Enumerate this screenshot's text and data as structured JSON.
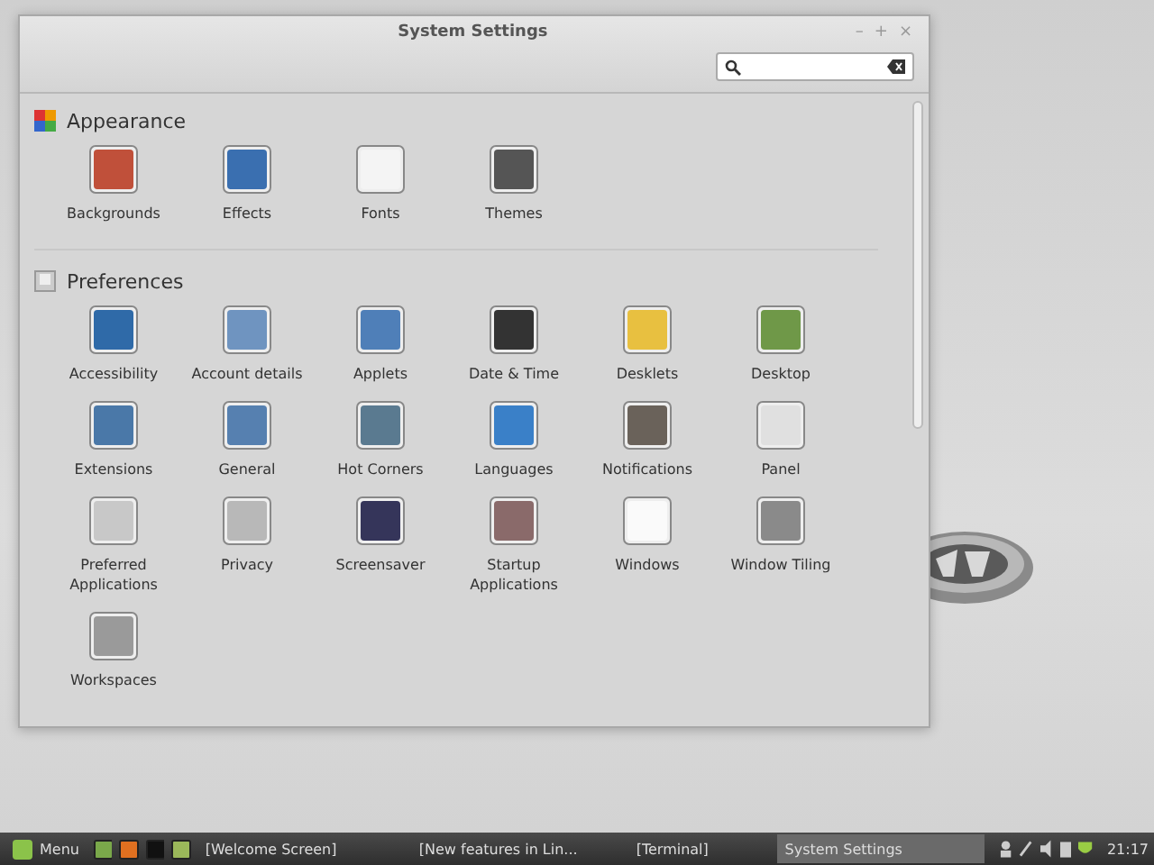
{
  "window": {
    "title": "System Settings",
    "controls": [
      "–",
      "+",
      "×"
    ]
  },
  "search": {
    "kind": "empty"
  },
  "sections": [
    {
      "title": "Appearance",
      "kind": "appearance",
      "items": [
        {
          "label": "Backgrounds",
          "color": "#c0503a"
        },
        {
          "label": "Effects",
          "color": "#3a6fb0"
        },
        {
          "label": "Fonts",
          "color": "#f4f4f4"
        },
        {
          "label": "Themes",
          "color": "#555555"
        }
      ]
    },
    {
      "title": "Preferences",
      "kind": "preferences",
      "items": [
        {
          "label": "Accessibility",
          "color": "#2f6aa8"
        },
        {
          "label": "Account details",
          "color": "#6f94c0"
        },
        {
          "label": "Applets",
          "color": "#4f7fb8"
        },
        {
          "label": "Date & Time",
          "color": "#333333"
        },
        {
          "label": "Desklets",
          "color": "#e8c040"
        },
        {
          "label": "Desktop",
          "color": "#6f9848"
        },
        {
          "label": "Extensions",
          "color": "#4a78a8"
        },
        {
          "label": "General",
          "color": "#5680b0"
        },
        {
          "label": "Hot Corners",
          "color": "#5a7a90"
        },
        {
          "label": "Languages",
          "color": "#3a80c8"
        },
        {
          "label": "Notifications",
          "color": "#6a625a"
        },
        {
          "label": "Panel",
          "color": "#e0e0e0"
        },
        {
          "label": "Preferred\nApplications",
          "color": "#c8c8c8"
        },
        {
          "label": "Privacy",
          "color": "#b8b8b8"
        },
        {
          "label": "Screensaver",
          "color": "#35355a"
        },
        {
          "label": "Startup\nApplications",
          "color": "#8a6a6a"
        },
        {
          "label": "Windows",
          "color": "#fafafa"
        },
        {
          "label": "Window Tiling",
          "color": "#8a8a8a"
        },
        {
          "label": "Workspaces",
          "color": "#9a9a9a"
        }
      ]
    }
  ],
  "taskbar": {
    "menu": "Menu",
    "windows": [
      {
        "label": "[Welcome Screen]",
        "selected": false
      },
      {
        "label": "[New features in Lin...",
        "selected": false
      },
      {
        "label": "[Terminal]",
        "selected": false
      },
      {
        "label": "System Settings",
        "selected": true
      }
    ],
    "clock": "21:17"
  }
}
